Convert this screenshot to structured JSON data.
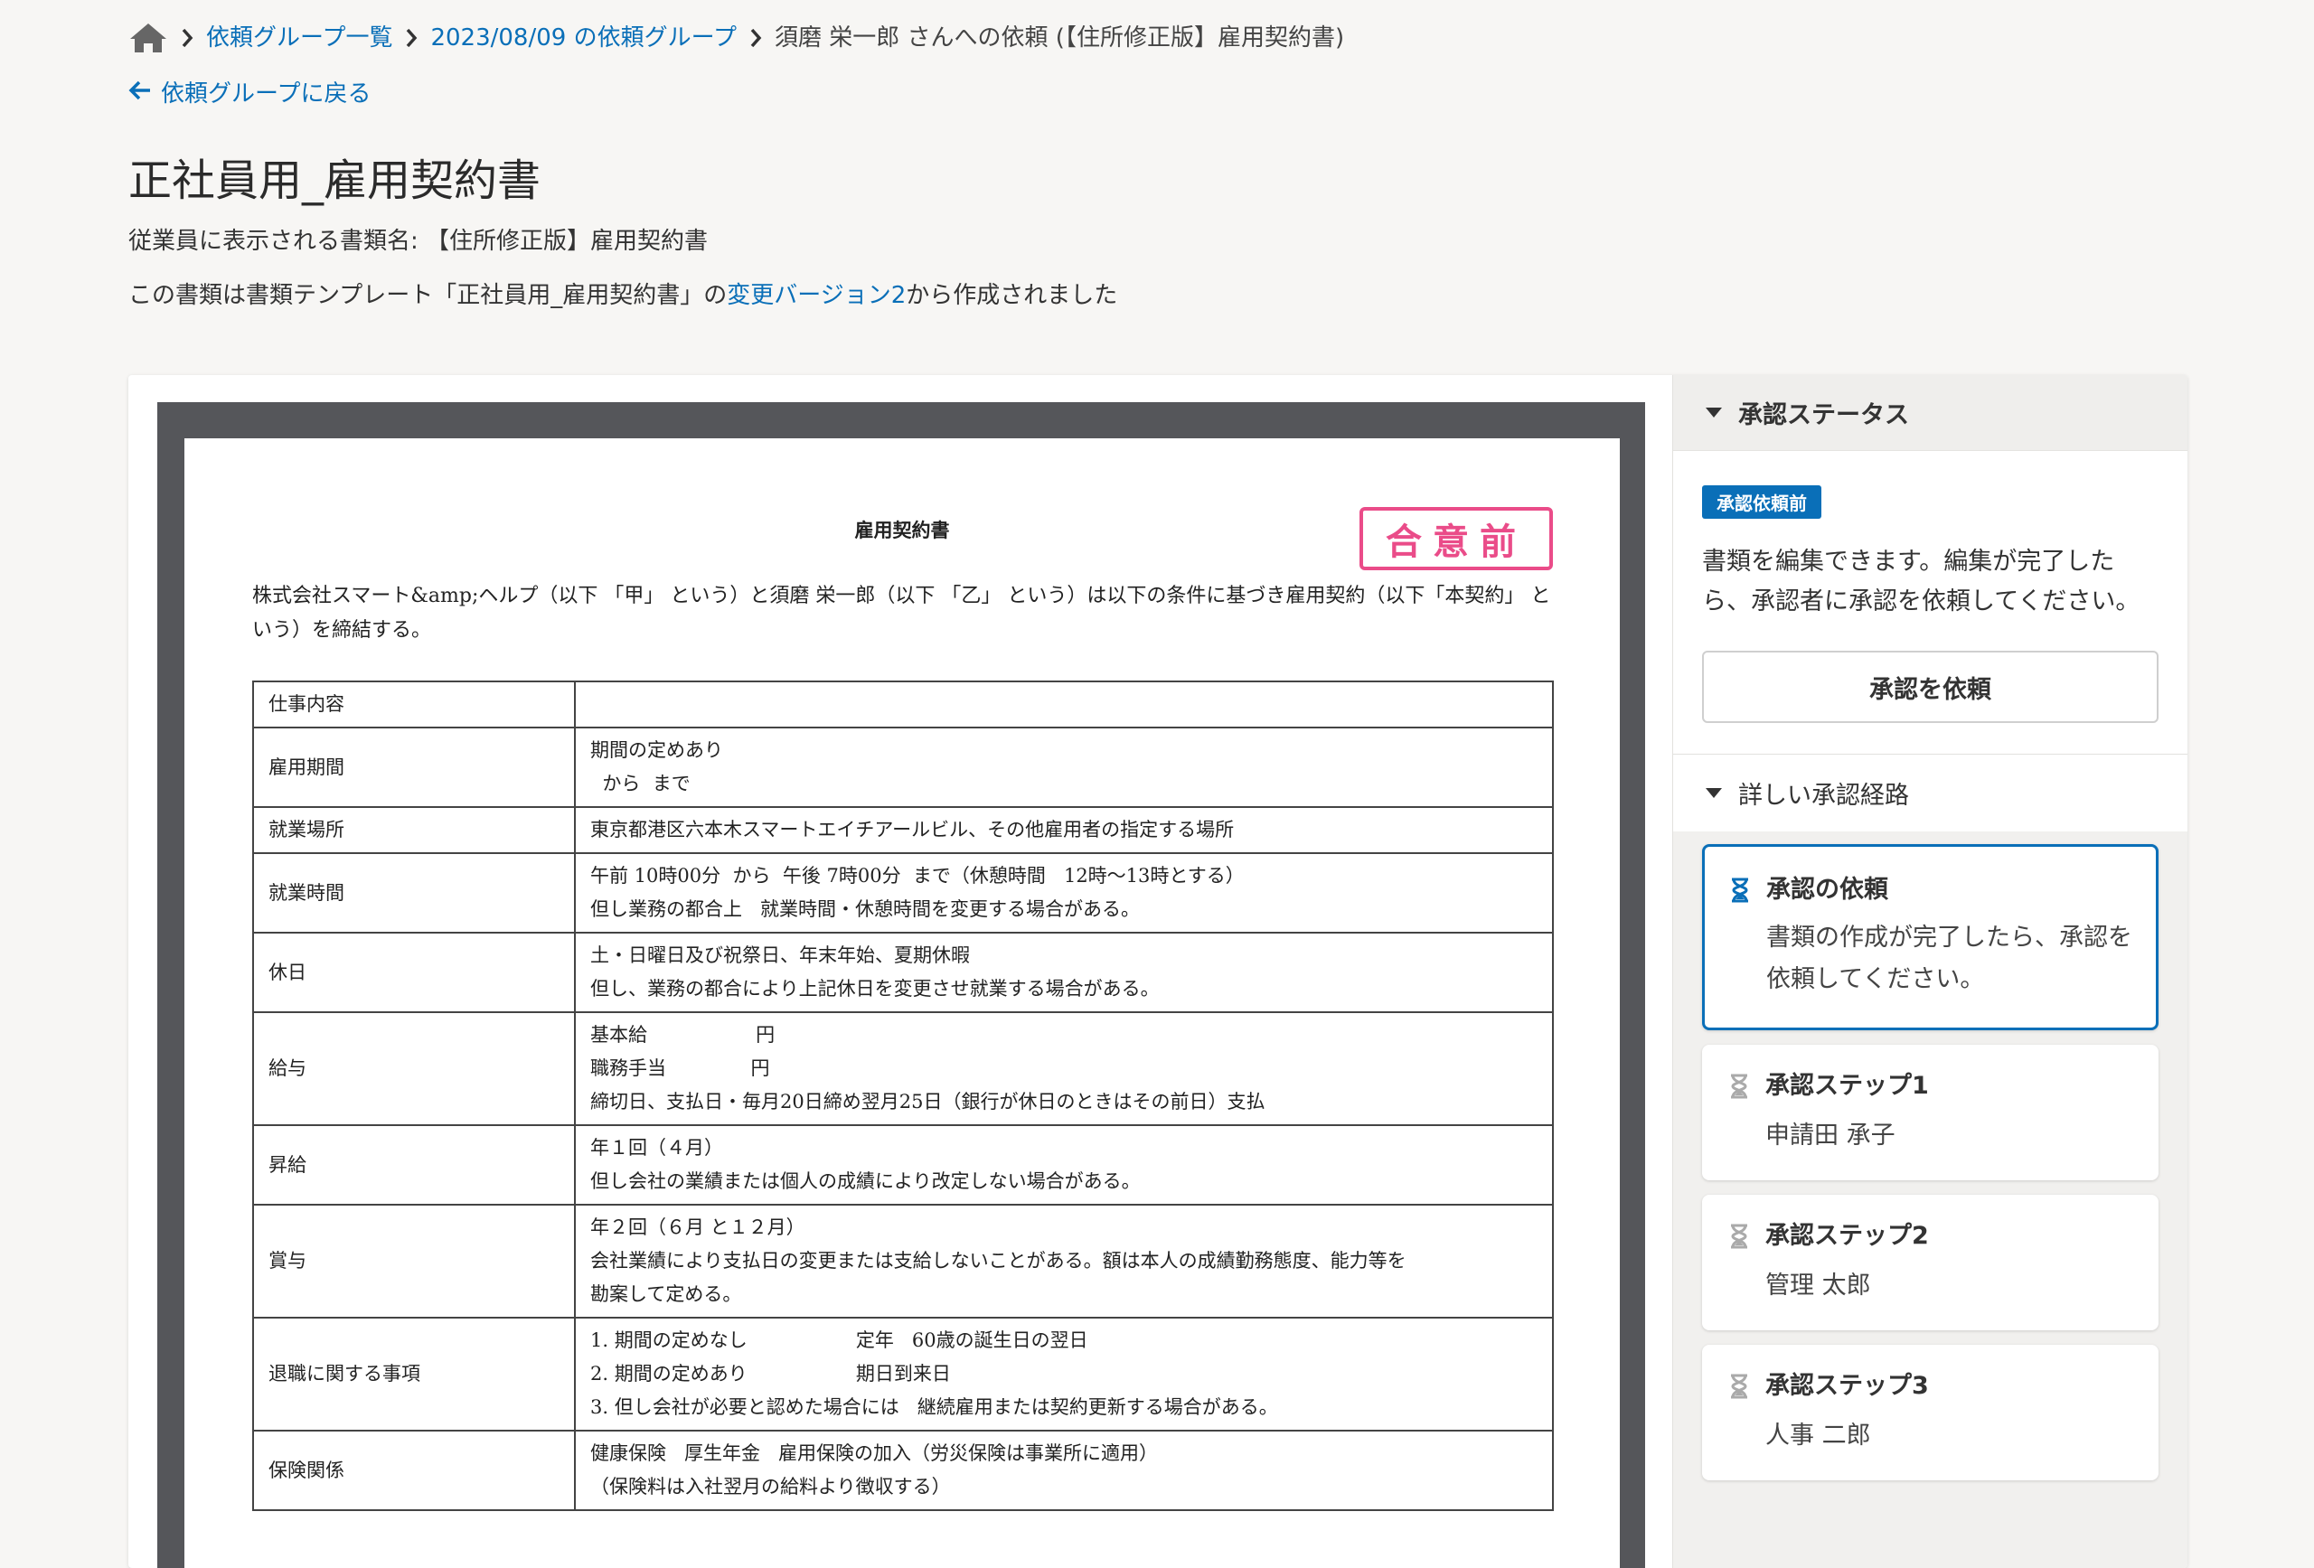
{
  "breadcrumb": {
    "items": [
      "依頼グループ一覧",
      "2023/08/09 の依頼グループ"
    ],
    "current": "須磨 栄一郎 さんへの依頼 (【住所修正版】雇用契約書)"
  },
  "back_link": "依頼グループに戻る",
  "page_title": "正社員用_雇用契約書",
  "display_name": "従業員に表示される書類名: 【住所修正版】雇用契約書",
  "template_note": {
    "before": "この書類は書類テンプレート「正社員用_雇用契約書」の",
    "link": "変更バージョン2",
    "after": "から作成されました"
  },
  "document": {
    "title": "雇用契約書",
    "stamp": "合意前",
    "intro": "株式会社スマート&amp;ヘルプ（以下 「甲」 という）と須磨 栄一郎（以下 「乙」 という）は以下の条件に基づき雇用契約（以下「本契約」 という）を締結する。",
    "rows": [
      {
        "key": "仕事内容",
        "lines": [
          ""
        ]
      },
      {
        "key": "雇用期間",
        "lines": [
          "期間の定めあり",
          "  から  まで"
        ]
      },
      {
        "key": "就業場所",
        "lines": [
          "東京都港区六本木スマートエイチアールビル、その他雇用者の指定する場所"
        ]
      },
      {
        "key": "就業時間",
        "lines": [
          "午前 10時00分  から  午後 7時00分  まで（休憩時間   12時〜13時とする）",
          "但し業務の都合上   就業時間・休憩時間を変更する場合がある。"
        ]
      },
      {
        "key": "休日",
        "lines": [
          "土・日曜日及び祝祭日、年末年始、夏期休暇",
          "但し、業務の都合により上記休日を変更させ就業する場合がある。"
        ]
      },
      {
        "key": "給与",
        "lines": [
          "基本給                  円",
          "職務手当              円",
          "締切日、支払日・毎月20日締め翌月25日（銀行が休日のときはその前日）支払"
        ]
      },
      {
        "key": "昇給",
        "lines": [
          "年１回（４月）",
          "但し会社の業績または個人の成績により改定しない場合がある。"
        ]
      },
      {
        "key": "賞与",
        "lines": [
          "年２回（６月 と１２月）",
          "会社業績により支払日の変更または支給しないことがある。額は本人の成績勤務態度、能力等を",
          "勘案して定める。"
        ]
      },
      {
        "key": "退職に関する事項",
        "lines": [
          "1. 期間の定めなし                  定年   60歳の誕生日の翌日",
          "2. 期間の定めあり                  期日到来日",
          "3. 但し会社が必要と認めた場合には   継続雇用または契約更新する場合がある。"
        ]
      },
      {
        "key": "保険関係",
        "lines": [
          "健康保険   厚生年金   雇用保険の加入（労災保険は事業所に適用）",
          "（保険料は入社翌月の給料より徴収する）"
        ]
      }
    ]
  },
  "side": {
    "status_header": "承認ステータス",
    "badge": "承認依頼前",
    "description": "書類を編集できます。編集が完了したら、承認者に承認を依頼してください。",
    "request_button": "承認を依頼",
    "route_header": "詳しい承認経路",
    "steps": [
      {
        "title": "承認の依頼",
        "text": "書類の作成が完了したら、承認を依頼してください。"
      },
      {
        "title": "承認ステップ1",
        "text": "申請田 承子"
      },
      {
        "title": "承認ステップ2",
        "text": "管理 太郎"
      },
      {
        "title": "承認ステップ3",
        "text": "人事 二郎"
      }
    ]
  },
  "colors": {
    "link": "#0a6fb8",
    "stamp": "#ea4c89",
    "active_border": "#0a6fb8"
  }
}
